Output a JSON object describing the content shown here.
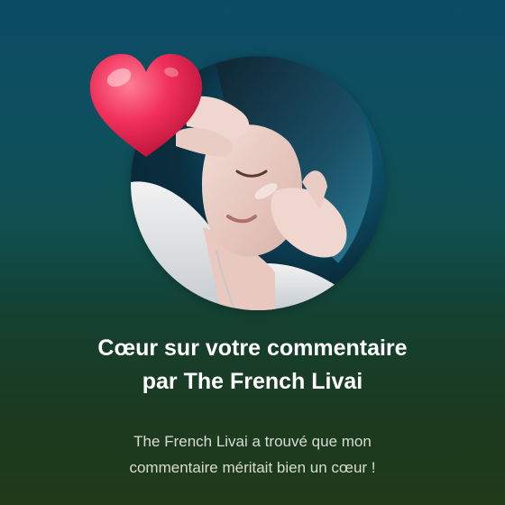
{
  "notification": {
    "title_line1": "Cœur sur votre commentaire",
    "title_line2": "par The French Livai",
    "body_line1": "The French Livai a trouvé que mon",
    "body_line2": "commentaire méritait bien un cœur !"
  },
  "icons": {
    "reaction": "heart-icon",
    "avatar": "creator-avatar"
  },
  "colors": {
    "background_top": "#0c4b64",
    "background_bottom": "#203a1a",
    "heart": "#f0305a",
    "title": "#ffffff",
    "body": "#d6dcd4"
  }
}
